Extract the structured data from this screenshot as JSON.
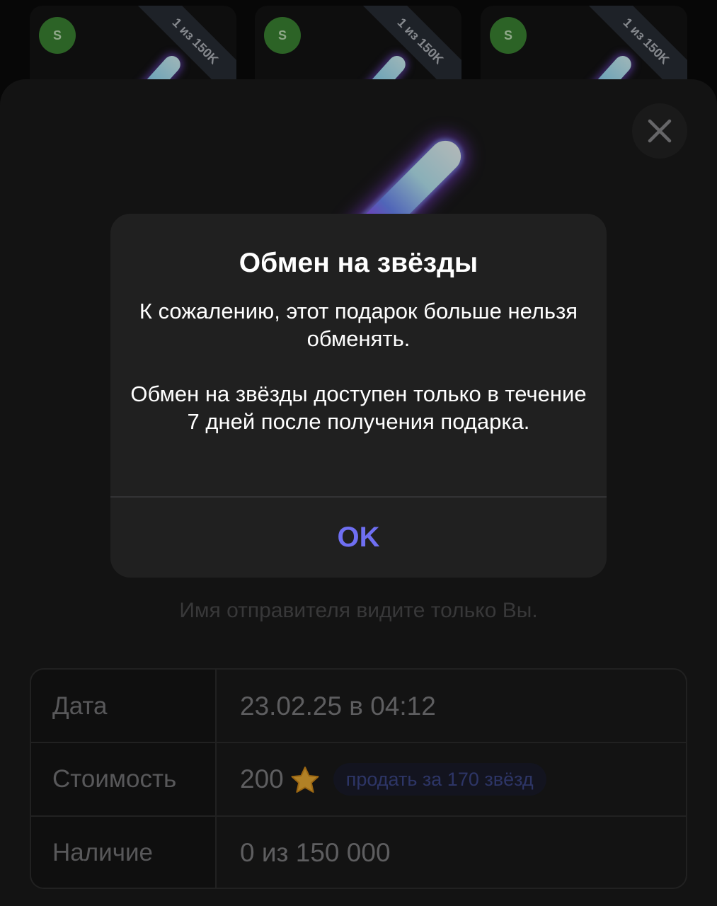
{
  "gift_cards": [
    {
      "avatar_letter": "S",
      "badge": "1 из 150K"
    },
    {
      "avatar_letter": "S",
      "badge": "1 из 150K"
    },
    {
      "avatar_letter": "S",
      "badge": "1 из 150K"
    }
  ],
  "sender_note": "Имя отправителя видите только Вы.",
  "info": {
    "date_label": "Дата",
    "date_value": "23.02.25 в 04:12",
    "price_label": "Стоимость",
    "price_value": "200",
    "sell_label": "продать за 170 звёзд",
    "availability_label": "Наличие",
    "availability_value": "0 из 150 000"
  },
  "alert": {
    "title": "Обмен на звёзды",
    "message_1": "К сожалению, этот подарок больше нельзя обменять.",
    "message_2": "Обмен на звёзды доступен только в течение 7 дней после получения подарка.",
    "ok_label": "OK"
  },
  "icons": {
    "close": "close-icon",
    "star": "star-icon"
  },
  "colors": {
    "accent": "#6f6ff2",
    "star": "#f5b335",
    "avatar": "#3e8a35"
  }
}
